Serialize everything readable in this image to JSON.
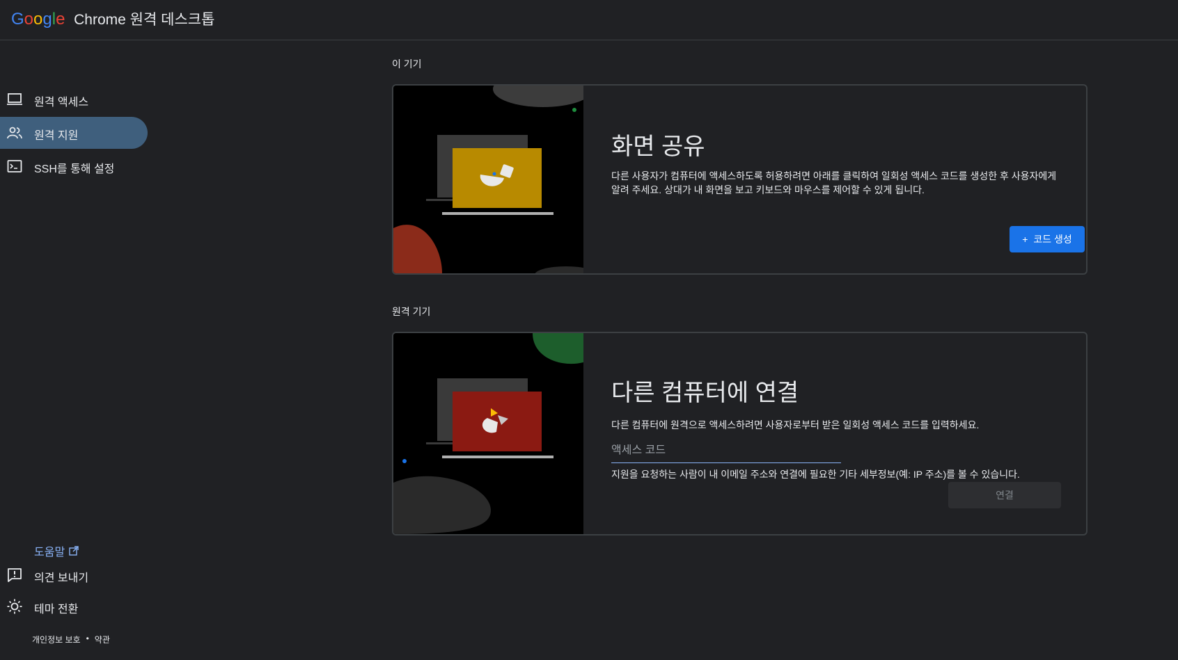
{
  "header": {
    "google_letters": [
      "G",
      "o",
      "o",
      "g",
      "l",
      "e"
    ],
    "product_name": "Chrome 원격 데스크톱"
  },
  "sidebar": {
    "items": [
      {
        "label": "원격 액세스",
        "icon": "laptop-icon",
        "active": false
      },
      {
        "label": "원격 지원",
        "icon": "people-icon",
        "active": true
      },
      {
        "label": "SSH를 통해 설정",
        "icon": "terminal-icon",
        "active": false
      }
    ],
    "help_label": "도움말",
    "feedback_label": "의견 보내기",
    "theme_label": "테마 전환",
    "footer": {
      "privacy": "개인정보 보호",
      "separator": "•",
      "terms": "약관"
    }
  },
  "main": {
    "this_device_title": "이 기기",
    "remote_device_title": "원격 기기",
    "share": {
      "heading": "화면 공유",
      "description": "다른 사용자가 컴퓨터에 액세스하도록 허용하려면 아래를 클릭하여 일회성 액세스 코드를 생성한 후 사용자에게 알려 주세요. 상대가 내 화면을 보고 키보드와 마우스를 제어할 수 있게 됩니다.",
      "button_label": "코드 생성",
      "button_icon": "+"
    },
    "connect": {
      "heading": "다른 컴퓨터에 연결",
      "description": "다른 컴퓨터에 원격으로 액세스하려면 사용자로부터 받은 일회성 액세스 코드를 입력하세요.",
      "input_placeholder": "액세스 코드",
      "input_value": "",
      "hint": "지원을 요청하는 사람이 내 이메일 주소와 연결에 필요한 기타 세부정보(예: IP 주소)를 볼 수 있습니다.",
      "button_label": "연결"
    }
  },
  "colors": {
    "accent": "#1a73e8",
    "active_nav": "#3f5f7d",
    "share_screen": "#b88a00",
    "connect_screen": "#8b1a12",
    "link": "#8ab4f8"
  }
}
